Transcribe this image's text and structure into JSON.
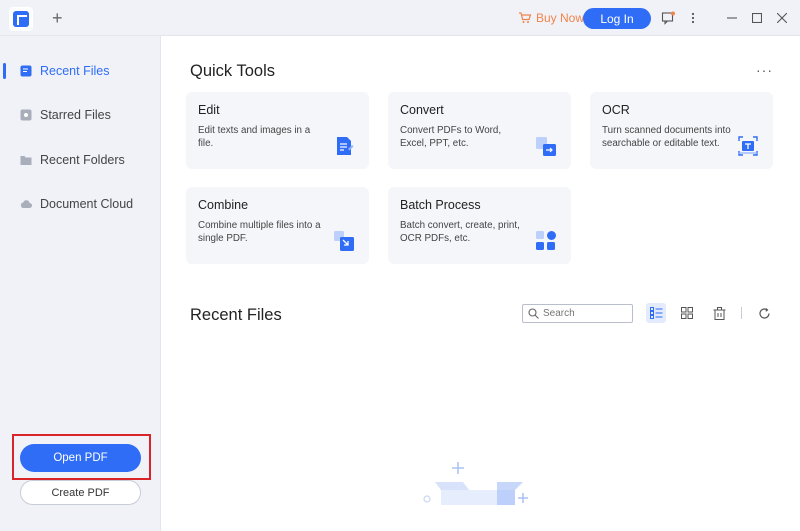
{
  "titlebar": {
    "buy_now_label": "Buy Now",
    "login_label": "Log In"
  },
  "sidebar": {
    "items": [
      {
        "label": "Recent Files",
        "icon": "recent-files-icon",
        "active": true
      },
      {
        "label": "Starred Files",
        "icon": "star-icon",
        "active": false
      },
      {
        "label": "Recent Folders",
        "icon": "folder-icon",
        "active": false
      },
      {
        "label": "Document Cloud",
        "icon": "cloud-icon",
        "active": false
      }
    ],
    "open_pdf_label": "Open PDF",
    "create_pdf_label": "Create PDF"
  },
  "quick_tools": {
    "title": "Quick Tools",
    "more_label": "···",
    "cards": [
      {
        "title": "Edit",
        "desc": "Edit texts and images in a file.",
        "icon": "edit-doc-icon"
      },
      {
        "title": "Convert",
        "desc": "Convert PDFs to Word, Excel, PPT, etc.",
        "icon": "convert-icon"
      },
      {
        "title": "OCR",
        "desc": "Turn scanned documents into searchable or editable text.",
        "icon": "ocr-scan-icon"
      },
      {
        "title": "Combine",
        "desc": "Combine multiple files into a single PDF.",
        "icon": "combine-icon"
      },
      {
        "title": "Batch Process",
        "desc": "Batch convert, create, print, OCR PDFs, etc.",
        "icon": "batch-process-icon"
      }
    ]
  },
  "recent_files": {
    "title": "Recent Files",
    "search_placeholder": "Search"
  },
  "colors": {
    "accent": "#2f6df6",
    "buy_now": "#f2844b",
    "highlight_frame": "#d9252a",
    "sidebar_bg": "#f0f2f7",
    "card_bg": "#f5f6fa"
  }
}
